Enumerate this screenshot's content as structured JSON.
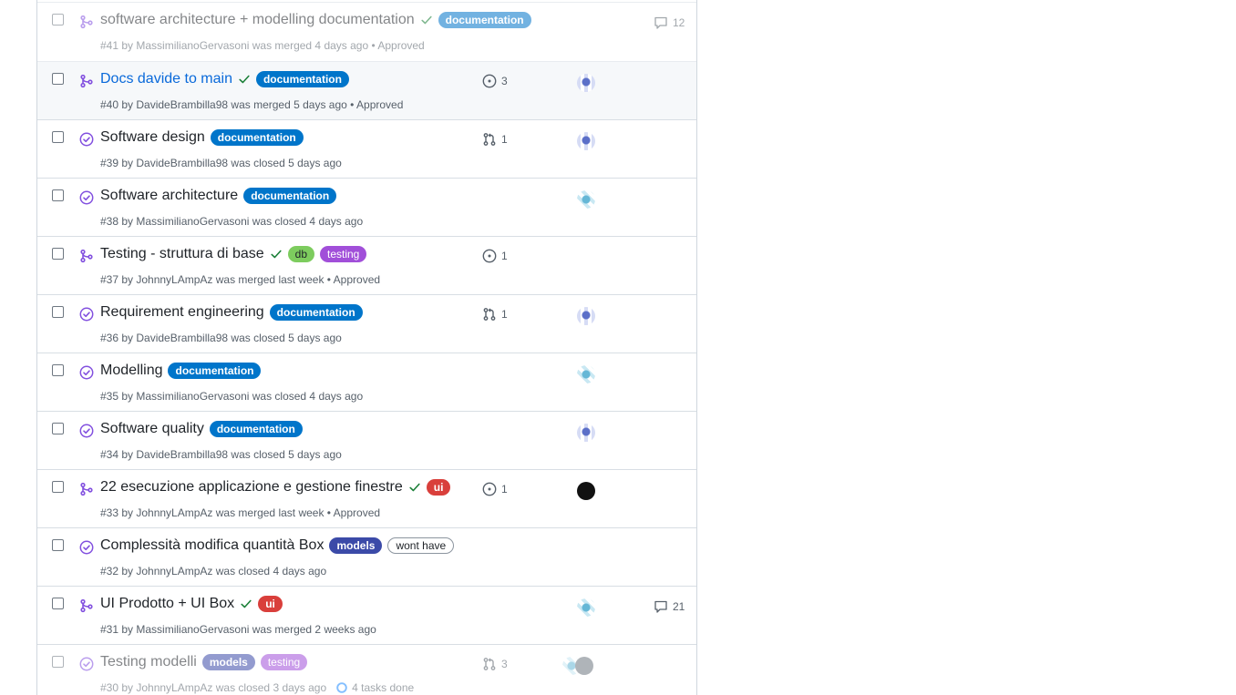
{
  "colors": {
    "merged": "#8250df",
    "closed": "#8250df",
    "check": "#1a7f37",
    "link": "#0969da"
  },
  "rows": [
    {
      "title": "software architecture + modelling documentation",
      "status": "merged",
      "check": true,
      "labels": [
        {
          "name": "documentation",
          "kind": "documentation"
        }
      ],
      "meta": "#41 by MassimilianoGervasoni was merged 4 days ago • Approved",
      "comments": "12",
      "faded": true
    },
    {
      "title": "Docs davide to main",
      "status": "merged",
      "check": true,
      "labels": [
        {
          "name": "documentation",
          "kind": "documentation"
        }
      ],
      "meta": "#40 by DavideBrambilla98 was merged 5 days ago • Approved",
      "ref_type": "issue",
      "ref_count": "3",
      "avatars": [
        "a"
      ],
      "hover": true
    },
    {
      "title": "Software design",
      "status": "closed",
      "labels": [
        {
          "name": "documentation",
          "kind": "documentation"
        }
      ],
      "meta": "#39 by DavideBrambilla98 was closed 5 days ago",
      "ref_type": "pr",
      "ref_count": "1",
      "avatars": [
        "a"
      ]
    },
    {
      "title": "Software architecture",
      "status": "closed",
      "labels": [
        {
          "name": "documentation",
          "kind": "documentation"
        }
      ],
      "meta": "#38 by MassimilianoGervasoni was closed 4 days ago",
      "avatars": [
        "b"
      ]
    },
    {
      "title": "Testing - struttura di base",
      "status": "merged",
      "check": true,
      "labels": [
        {
          "name": "db",
          "kind": "db"
        },
        {
          "name": "testing",
          "kind": "testing"
        }
      ],
      "meta": "#37 by JohnnyLAmpAz was merged last week • Approved",
      "ref_type": "issue",
      "ref_count": "1"
    },
    {
      "title": "Requirement engineering",
      "status": "closed",
      "labels": [
        {
          "name": "documentation",
          "kind": "documentation"
        }
      ],
      "meta": "#36 by DavideBrambilla98 was closed 5 days ago",
      "ref_type": "pr",
      "ref_count": "1",
      "avatars": [
        "a"
      ]
    },
    {
      "title": "Modelling",
      "status": "closed",
      "labels": [
        {
          "name": "documentation",
          "kind": "documentation"
        }
      ],
      "meta": "#35 by MassimilianoGervasoni was closed 4 days ago",
      "avatars": [
        "b"
      ]
    },
    {
      "title": "Software quality",
      "status": "closed",
      "labels": [
        {
          "name": "documentation",
          "kind": "documentation"
        }
      ],
      "meta": "#34 by DavideBrambilla98 was closed 5 days ago",
      "avatars": [
        "a"
      ]
    },
    {
      "title": "22 esecuzione applicazione e gestione finestre",
      "status": "merged",
      "check": true,
      "labels": [
        {
          "name": "ui",
          "kind": "ui"
        }
      ],
      "meta": "#33 by JohnnyLAmpAz was merged last week • Approved",
      "ref_type": "issue",
      "ref_count": "1",
      "avatars": [
        "c"
      ]
    },
    {
      "title": "Complessità modifica quantità Box",
      "status": "closed",
      "labels": [
        {
          "name": "models",
          "kind": "models"
        },
        {
          "name": "wont have",
          "kind": "wonthave"
        }
      ],
      "meta": "#32 by JohnnyLAmpAz was closed 4 days ago"
    },
    {
      "title": "UI Prodotto + UI Box",
      "status": "merged",
      "check": true,
      "labels": [
        {
          "name": "ui",
          "kind": "ui"
        }
      ],
      "meta": "#31 by MassimilianoGervasoni was merged 2 weeks ago",
      "avatars": [
        "b"
      ],
      "comments": "21"
    },
    {
      "title": "Testing modelli",
      "status": "closed",
      "labels": [
        {
          "name": "models",
          "kind": "models"
        },
        {
          "name": "testing",
          "kind": "testing"
        }
      ],
      "meta": "#30 by JohnnyLAmpAz was closed 3 days ago",
      "tasks": "4 tasks done",
      "ref_type": "pr",
      "ref_count": "3",
      "avatars": [
        "b",
        "d"
      ],
      "faded": true
    }
  ]
}
